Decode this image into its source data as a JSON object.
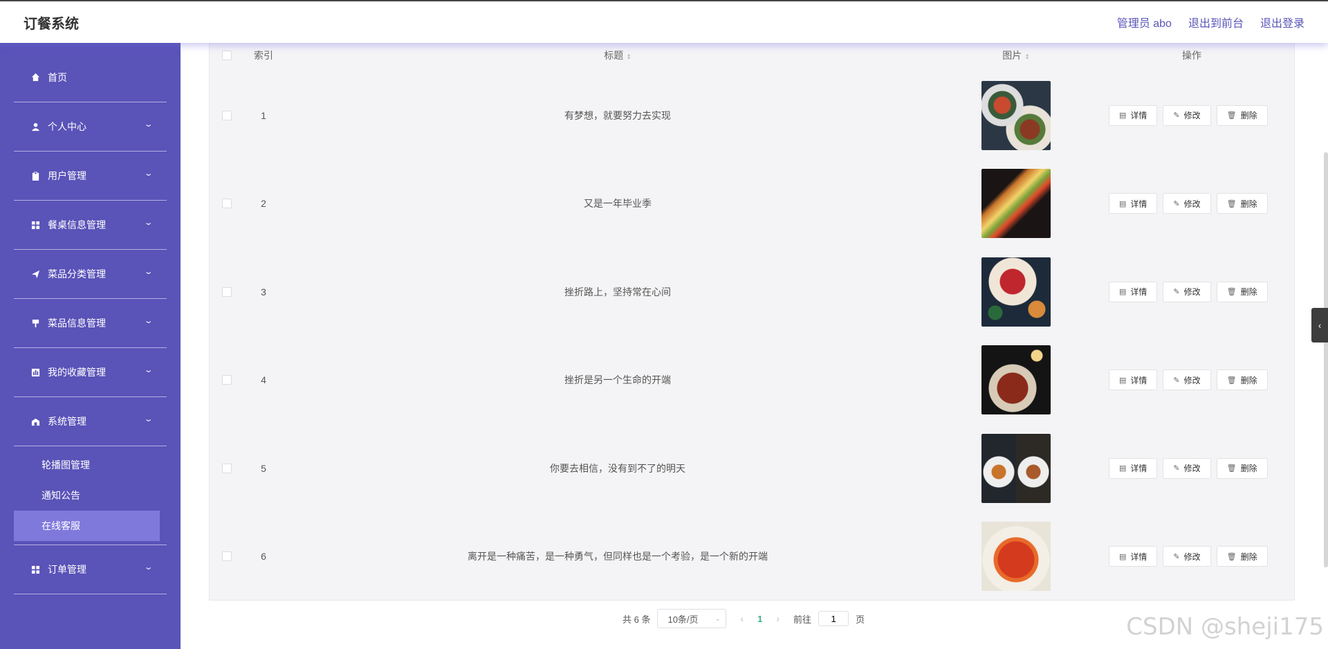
{
  "header": {
    "brand": "订餐系统",
    "admin_label": "管理员 abo",
    "to_front": "退出到前台",
    "logout": "退出登录"
  },
  "sidebar": {
    "items": [
      {
        "label": "首页",
        "icon": "home-icon"
      },
      {
        "label": "个人中心",
        "icon": "user-icon"
      },
      {
        "label": "用户管理",
        "icon": "clipboard-icon"
      },
      {
        "label": "餐桌信息管理",
        "icon": "grid-icon"
      },
      {
        "label": "菜品分类管理",
        "icon": "send-icon"
      },
      {
        "label": "菜品信息管理",
        "icon": "flag-icon"
      },
      {
        "label": "我的收藏管理",
        "icon": "chart-icon"
      },
      {
        "label": "系统管理",
        "icon": "gear-icon"
      }
    ],
    "sub_items": [
      "轮播图管理",
      "通知公告",
      "在线客服"
    ],
    "last_item": {
      "label": "订单管理",
      "icon": "grid-icon"
    }
  },
  "table": {
    "headers": {
      "index": "索引",
      "title": "标题",
      "image": "图片",
      "actions": "操作"
    },
    "rows": [
      {
        "index": "1",
        "title": "有梦想，就要努力去实现"
      },
      {
        "index": "2",
        "title": "又是一年毕业季"
      },
      {
        "index": "3",
        "title": "挫折路上，坚持常在心间"
      },
      {
        "index": "4",
        "title": "挫折是另一个生命的开端"
      },
      {
        "index": "5",
        "title": "你要去相信，没有到不了的明天"
      },
      {
        "index": "6",
        "title": "离开是一种痛苦，是一种勇气，但同样也是一个考验，是一个新的开端"
      }
    ],
    "actions": {
      "detail": "详情",
      "edit": "修改",
      "delete": "删除"
    }
  },
  "pagination": {
    "total": "共 6 条",
    "page_size": "10条/页",
    "current_page": "1",
    "goto_label": "前往",
    "goto_value": "1",
    "page_suffix": "页"
  },
  "watermark": "CSDN @sheji175"
}
